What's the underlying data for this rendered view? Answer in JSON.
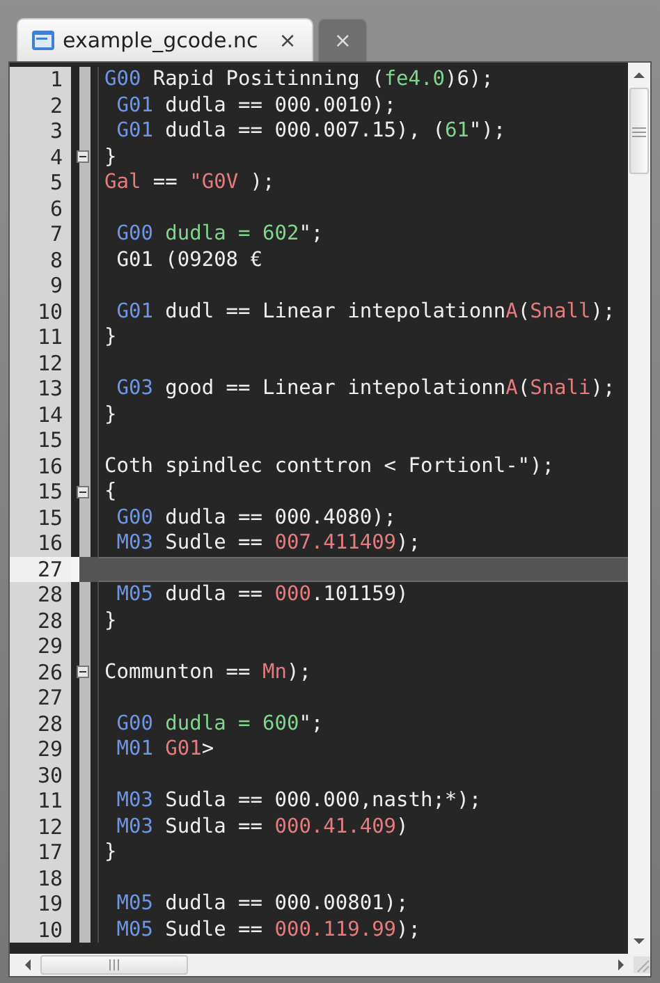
{
  "tabs": [
    {
      "label": "example_gcode.nc",
      "close": "×",
      "selected": true
    },
    {
      "close": "×",
      "selected": false
    }
  ],
  "lines": [
    {
      "number": "1",
      "fold": false,
      "selected": false,
      "tokens": [
        {
          "kind": "keyword",
          "text": "G00"
        },
        {
          "kind": "plain",
          "text": " Rapid Positinning ("
        },
        {
          "kind": "string",
          "text": "fe4.0"
        },
        {
          "kind": "plain",
          "text": ")6);"
        }
      ]
    },
    {
      "number": "2",
      "fold": false,
      "selected": false,
      "tokens": [
        {
          "kind": "keyword",
          "text": " G01"
        },
        {
          "kind": "plain",
          "text": " dudla == 000.0010);"
        }
      ]
    },
    {
      "number": "3",
      "fold": false,
      "selected": false,
      "tokens": [
        {
          "kind": "keyword",
          "text": " G01"
        },
        {
          "kind": "plain",
          "text": " dudla == 000.007.15), ("
        },
        {
          "kind": "string",
          "text": "61"
        },
        {
          "kind": "plain",
          "text": "\");"
        }
      ]
    },
    {
      "number": "4",
      "fold": true,
      "selected": false,
      "tokens": [
        {
          "kind": "plain",
          "text": "}"
        }
      ]
    },
    {
      "number": "5",
      "fold": false,
      "selected": false,
      "tokens": [
        {
          "kind": "number",
          "text": "Gal"
        },
        {
          "kind": "plain",
          "text": " == "
        },
        {
          "kind": "number",
          "text": "\"G0V"
        },
        {
          "kind": "plain",
          "text": " );"
        }
      ]
    },
    {
      "number": "6",
      "fold": false,
      "selected": false
    },
    {
      "number": "7",
      "fold": false,
      "selected": false,
      "tokens": [
        {
          "kind": "keyword",
          "text": " G00"
        },
        {
          "kind": "string",
          "text": " dudla = 602"
        },
        {
          "kind": "plain",
          "text": "\";"
        }
      ]
    },
    {
      "number": "8",
      "fold": false,
      "selected": false,
      "tokens": [
        {
          "kind": "plain",
          "text": " G01 (09208 €"
        }
      ]
    },
    {
      "number": "9",
      "fold": false,
      "selected": false
    },
    {
      "number": "10",
      "fold": false,
      "selected": false,
      "tokens": [
        {
          "kind": "keyword",
          "text": " G01"
        },
        {
          "kind": "plain",
          "text": " dudl == Linear intepolationn"
        },
        {
          "kind": "number",
          "text": "A"
        },
        {
          "kind": "plain",
          "text": "("
        },
        {
          "kind": "number",
          "text": "Snall"
        },
        {
          "kind": "plain",
          "text": ");"
        }
      ]
    },
    {
      "number": "11",
      "fold": false,
      "selected": false,
      "tokens": [
        {
          "kind": "plain",
          "text": "}"
        }
      ]
    },
    {
      "number": "12",
      "fold": false,
      "selected": false
    },
    {
      "number": "13",
      "fold": false,
      "selected": false,
      "tokens": [
        {
          "kind": "keyword",
          "text": " G03"
        },
        {
          "kind": "plain",
          "text": " good == Linear intepolationn"
        },
        {
          "kind": "number",
          "text": "A"
        },
        {
          "kind": "plain",
          "text": "("
        },
        {
          "kind": "number",
          "text": "Snali"
        },
        {
          "kind": "plain",
          "text": ");"
        }
      ]
    },
    {
      "number": "14",
      "fold": false,
      "selected": false,
      "tokens": [
        {
          "kind": "plain",
          "text": "}"
        }
      ]
    },
    {
      "number": "15",
      "fold": false,
      "selected": false
    },
    {
      "number": "16",
      "fold": false,
      "selected": false,
      "tokens": [
        {
          "kind": "plain",
          "text": "Coth spindlec conttron < Fortionl-\");"
        }
      ]
    },
    {
      "number": "15",
      "fold": true,
      "selected": false,
      "tokens": [
        {
          "kind": "plain",
          "text": "{"
        }
      ]
    },
    {
      "number": "15",
      "fold": false,
      "selected": false,
      "tokens": [
        {
          "kind": "keyword",
          "text": " G00"
        },
        {
          "kind": "plain",
          "text": " dudla == 000.4080);"
        }
      ]
    },
    {
      "number": "16",
      "fold": false,
      "selected": false,
      "tokens": [
        {
          "kind": "keyword",
          "text": " M03"
        },
        {
          "kind": "plain",
          "text": " Sudle == "
        },
        {
          "kind": "number",
          "text": "007.411409"
        },
        {
          "kind": "plain",
          "text": ");"
        }
      ]
    },
    {
      "number": "27",
      "fold": false,
      "selected": true
    },
    {
      "number": "28",
      "fold": false,
      "selected": false,
      "tokens": [
        {
          "kind": "keyword",
          "text": " M05"
        },
        {
          "kind": "plain",
          "text": " dudla == "
        },
        {
          "kind": "number",
          "text": "000"
        },
        {
          "kind": "plain",
          "text": ".101159)"
        }
      ]
    },
    {
      "number": "28",
      "fold": false,
      "selected": false,
      "tokens": [
        {
          "kind": "plain",
          "text": "}"
        }
      ]
    },
    {
      "number": "29",
      "fold": false,
      "selected": false
    },
    {
      "number": "26",
      "fold": true,
      "selected": false,
      "tokens": [
        {
          "kind": "plain",
          "text": "Communton == "
        },
        {
          "kind": "number",
          "text": "Mn"
        },
        {
          "kind": "plain",
          "text": ");"
        }
      ]
    },
    {
      "number": "27",
      "fold": false,
      "selected": false
    },
    {
      "number": "28",
      "fold": false,
      "selected": false,
      "tokens": [
        {
          "kind": "keyword",
          "text": " G00"
        },
        {
          "kind": "string",
          "text": " dudla = 600"
        },
        {
          "kind": "plain",
          "text": "\";"
        }
      ]
    },
    {
      "number": "29",
      "fold": false,
      "selected": false,
      "tokens": [
        {
          "kind": "keyword",
          "text": " M01"
        },
        {
          "kind": "number",
          "text": " G01"
        },
        {
          "kind": "plain",
          "text": ">"
        }
      ]
    },
    {
      "number": "30",
      "fold": false,
      "selected": false
    },
    {
      "number": "11",
      "fold": false,
      "selected": false,
      "tokens": [
        {
          "kind": "keyword",
          "text": " M03"
        },
        {
          "kind": "plain",
          "text": " Sudla == 000.000,nasth;*);"
        }
      ]
    },
    {
      "number": "12",
      "fold": false,
      "selected": false,
      "tokens": [
        {
          "kind": "keyword",
          "text": " M03"
        },
        {
          "kind": "plain",
          "text": " Sudla == "
        },
        {
          "kind": "number",
          "text": "000.41.409"
        },
        {
          "kind": "plain",
          "text": ")"
        }
      ]
    },
    {
      "number": "17",
      "fold": false,
      "selected": false,
      "tokens": [
        {
          "kind": "plain",
          "text": "}"
        }
      ]
    },
    {
      "number": "18",
      "fold": false,
      "selected": false
    },
    {
      "number": "19",
      "fold": false,
      "selected": false,
      "tokens": [
        {
          "kind": "keyword",
          "text": " M05"
        },
        {
          "kind": "plain",
          "text": " dudla == 000.00801);"
        }
      ]
    },
    {
      "number": "10",
      "fold": false,
      "selected": false,
      "tokens": [
        {
          "kind": "keyword",
          "text": " M05"
        },
        {
          "kind": "plain",
          "text": " Sudle == "
        },
        {
          "kind": "number",
          "text": "000.119.99"
        },
        {
          "kind": "plain",
          "text": ");"
        }
      ]
    }
  ]
}
